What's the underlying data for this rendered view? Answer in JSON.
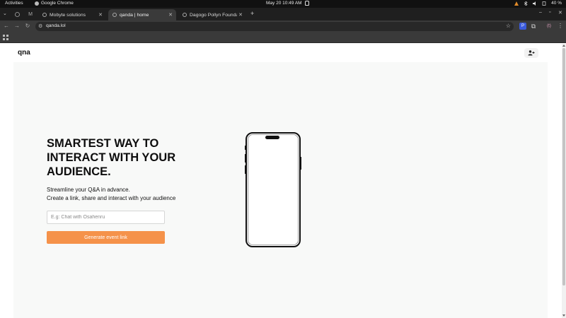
{
  "os": {
    "activities": "Activities",
    "app_name": "Google Chrome",
    "clock": "May 20  10:49 AM",
    "battery": "40 %"
  },
  "browser": {
    "tabs": [
      {
        "label": "Mobyte solutions",
        "active": false
      },
      {
        "label": "qanda | home",
        "active": true
      },
      {
        "label": "Dagogo Pollyn Foundati",
        "active": false
      }
    ],
    "url": "qanda.lol",
    "profile_badge": "(t)"
  },
  "page": {
    "brand": "qna",
    "headline": "SMARTEST WAY TO INTERACT WITH YOUR AUDIENCE.",
    "subtext_line1": "Streamline your Q&A in advance.",
    "subtext_line2": "Create a link, share and interact with your audience",
    "input_placeholder": "E.g: Chat with Osahenru",
    "input_value": "",
    "generate_button": "Generate event link"
  },
  "colors": {
    "accent": "#f5924a",
    "hero_bg": "#f8f9f8"
  },
  "icons": {
    "user_button": "add-user-icon"
  }
}
